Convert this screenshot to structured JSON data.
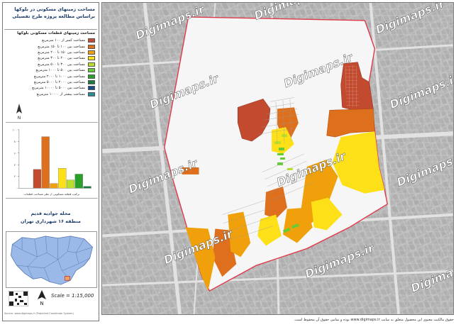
{
  "title": {
    "line1": "مساحت زمینهای مسکونی در بلوکها",
    "line2": "براساس مطالعه پروژه طرح تفصیلی"
  },
  "legend": {
    "heading": "مساحت زمینهای قطعات مسکونی بلوکها",
    "items": [
      {
        "label": "مساحت کمتر از ۱۰۰ مترمربع",
        "color": "#c24a2e"
      },
      {
        "label": "مساحت بین ۱۰۰ تا ۱۵۰ مترمربع",
        "color": "#de6f1c"
      },
      {
        "label": "مساحت بین ۱۵۰ تا ۲۰۰ مترمربع",
        "color": "#f0a00a"
      },
      {
        "label": "مساحت بین ۲۰۰ تا ۳۰۰ مترمربع",
        "color": "#fde018"
      },
      {
        "label": "مساحت بین ۳۰۰ تا ۵۰۰ مترمربع",
        "color": "#b8e02a"
      },
      {
        "label": "مساحت بین ۵۰۰ تا ۱۰۰۰ مترمربع",
        "color": "#66cc33"
      },
      {
        "label": "مساحت بین ۱۰۰۰ تا ۲۰۰۰ مترمربع",
        "color": "#2aa02a"
      },
      {
        "label": "مساحت بین ۲۰۰۰ تا ۵۰۰۰ مترمربع",
        "color": "#1a7a40"
      },
      {
        "label": "مساحت بین ۵۰۰۰ تا ۱۰۰۰۰ مترمربع",
        "color": "#1a4a8a"
      },
      {
        "label": "مساحت بیشتر از ۱۰۰۰۰ مترمربع",
        "color": "#2a8a9a"
      }
    ]
  },
  "chart_data": {
    "type": "bar",
    "bars": [
      {
        "value": 32,
        "color": "#c24a2e"
      },
      {
        "value": 88,
        "color": "#de6f1c"
      },
      {
        "value": 8,
        "color": "#f0a00a"
      },
      {
        "value": 34,
        "color": "#fde018"
      },
      {
        "value": 14,
        "color": "#b8e02a"
      },
      {
        "value": 24,
        "color": "#2aa02a"
      },
      {
        "value": 3,
        "color": "#1a7a40"
      }
    ],
    "ylim": [
      0,
      100
    ],
    "yticks": [
      "۰",
      "۲۰",
      "۴۰",
      "۶۰",
      "۸۰",
      "۱۰۰"
    ],
    "caption": "ترکیب قطعه مسکونی از نظر مساحت قطعات"
  },
  "area": {
    "name": "محله جوادیه قدیم",
    "district": "منطقه ۱۶ شهرداری تهران"
  },
  "scale": "Scale = 1:15,000",
  "footnote": "Source: www.digimaps.ir  (Projected Coordinate System)",
  "copyright": "حقوق مالکیت معنوی این محصول متعلق به سایت www.digimaps.ir بوده و تمامی حقوق آن محفوظ است.",
  "watermarks": [
    "Digimaps.ir",
    "Digimaps.ir",
    "Digimaps.ir",
    "Digimaps.ir",
    "Digimaps.ir",
    "Digimaps.ir",
    "Digimaps.ir",
    "Digimaps.ir",
    "Digimaps.ir",
    "Digimaps.ir",
    "Digimaps.ir",
    "Digimaps.ir"
  ],
  "colors": {
    "boundary": "#e03a4a",
    "street_grey": "#c9c9c9",
    "block_grey": "#b3b3b3",
    "title": "#1a3a6a",
    "district_blue": "#9ab8e8",
    "district_highlight": "#f0a060"
  }
}
